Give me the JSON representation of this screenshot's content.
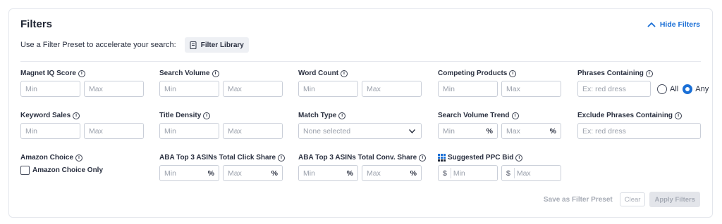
{
  "header": {
    "title": "Filters",
    "hide_filters_label": "Hide Filters"
  },
  "preset": {
    "text": "Use a Filter Preset to accelerate your search:",
    "library_label": "Filter Library"
  },
  "fields": {
    "magnet_iq": {
      "label": "Magnet IQ Score",
      "min": "Min",
      "max": "Max"
    },
    "search_volume": {
      "label": "Search Volume",
      "min": "Min",
      "max": "Max"
    },
    "word_count": {
      "label": "Word Count",
      "min": "Min",
      "max": "Max"
    },
    "competing_products": {
      "label": "Competing Products",
      "min": "Min",
      "max": "Max"
    },
    "phrases_containing": {
      "label": "Phrases Containing",
      "placeholder": "Ex: red dress",
      "all_label": "All",
      "any_label": "Any",
      "selected": "Any"
    },
    "keyword_sales": {
      "label": "Keyword Sales",
      "min": "Min",
      "max": "Max"
    },
    "title_density": {
      "label": "Title Density",
      "min": "Min",
      "max": "Max"
    },
    "match_type": {
      "label": "Match Type",
      "value": "None selected"
    },
    "search_volume_trend": {
      "label": "Search Volume Trend",
      "min": "Min",
      "max": "Max",
      "suffix": "%"
    },
    "exclude_phrases": {
      "label": "Exclude Phrases Containing",
      "placeholder": "Ex: red dress"
    },
    "amazon_choice": {
      "label": "Amazon Choice",
      "checkbox_label": "Amazon Choice Only",
      "checked": false
    },
    "aba_click_share": {
      "label": "ABA Top 3 ASINs Total Click Share",
      "min": "Min",
      "max": "Max",
      "suffix": "%"
    },
    "aba_conv_share": {
      "label": "ABA Top 3 ASINs Total Conv. Share",
      "min": "Min",
      "max": "Max",
      "suffix": "%"
    },
    "ppc_bid": {
      "label": "Suggested PPC Bid",
      "min": "Min",
      "max": "Max",
      "prefix": "$"
    }
  },
  "footer": {
    "save_preset_label": "Save as Filter Preset",
    "clear_label": "Clear",
    "apply_label": "Apply Filters"
  },
  "colors": {
    "accent": "#1a6fd6",
    "disabled_text": "#a6abb5",
    "border": "#c9ced8"
  },
  "icons": [
    "chevron-up-icon",
    "book-icon",
    "info-icon",
    "chevron-down-icon",
    "grid-icon"
  ]
}
